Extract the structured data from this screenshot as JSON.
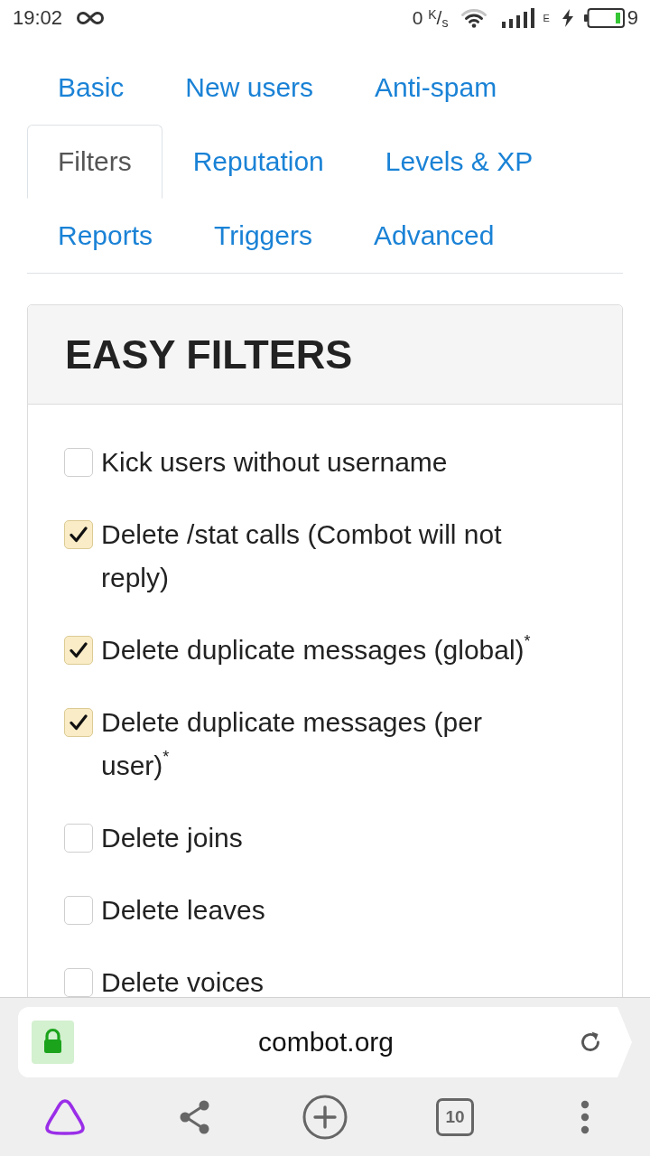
{
  "status_bar": {
    "time": "19:02",
    "net_speed": "0 $^{K}$/$_{s}$",
    "network_type": "E",
    "battery": "9"
  },
  "tabs": [
    {
      "label": "Basic",
      "selected": false
    },
    {
      "label": "New users",
      "selected": false
    },
    {
      "label": "Anti-spam",
      "selected": false
    },
    {
      "label": "Filters",
      "selected": true
    },
    {
      "label": "Reputation",
      "selected": false
    },
    {
      "label": "Levels & XP",
      "selected": false
    },
    {
      "label": "Reports",
      "selected": false
    },
    {
      "label": "Triggers",
      "selected": false
    },
    {
      "label": "Advanced",
      "selected": false
    }
  ],
  "panel": {
    "title": "EASY FILTERS",
    "items": [
      {
        "label": "Kick users without username",
        "checked": false
      },
      {
        "label": "Delete /stat calls (Combot will not reply)",
        "checked": true
      },
      {
        "label": "Delete duplicate messages (global)$^{*}$",
        "checked": true
      },
      {
        "label": "Delete duplicate messages (per user)$^{*}$",
        "checked": true
      },
      {
        "label": "Delete joins",
        "checked": false
      },
      {
        "label": "Delete leaves",
        "checked": false
      },
      {
        "label": "Delete voices",
        "checked": false
      }
    ]
  },
  "browser": {
    "url": "combot.org",
    "tab_count": "10"
  }
}
